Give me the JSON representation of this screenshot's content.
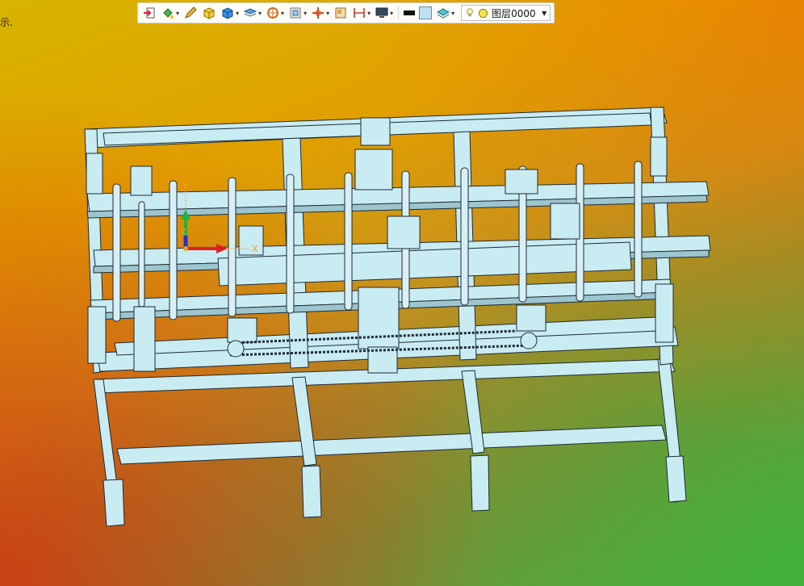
{
  "status": {
    "text": "示."
  },
  "toolbar": {
    "buttons": [
      {
        "icon": "exit-icon",
        "caret": false
      },
      {
        "icon": "paint-bucket-icon",
        "caret": true
      },
      {
        "icon": "pencil-icon",
        "caret": false
      },
      {
        "icon": "solid-box-yellow-icon",
        "caret": false
      },
      {
        "icon": "solid-box-blue-icon",
        "caret": true
      },
      {
        "icon": "display-style-icon",
        "caret": true
      },
      {
        "icon": "section-view-icon",
        "caret": true
      },
      {
        "icon": "zoom-fit-icon",
        "caret": true
      },
      {
        "icon": "snap-point-icon",
        "caret": true
      },
      {
        "icon": "view-box-icon",
        "caret": false
      },
      {
        "icon": "dimension-icon",
        "caret": true
      },
      {
        "icon": "monitor-icon",
        "caret": true
      },
      {
        "icon": "line-weight-icon",
        "caret": false
      },
      {
        "icon": "color-swatch-icon",
        "caret": false
      },
      {
        "icon": "layers-icon",
        "caret": true
      }
    ],
    "layer": {
      "name": "图层0000",
      "bulb": "on",
      "color": "#f1e34a"
    }
  },
  "colors": {
    "frame_face": "#c9ecf3",
    "frame_edge": "#1e2a33",
    "axis_x": "#e02020",
    "axis_y": "#20b040",
    "axis_z": "#2030d0",
    "axis_origin": "#f0a020"
  },
  "triad": {
    "x_label": "X",
    "y_label": "Y",
    "z_label": "Z"
  }
}
